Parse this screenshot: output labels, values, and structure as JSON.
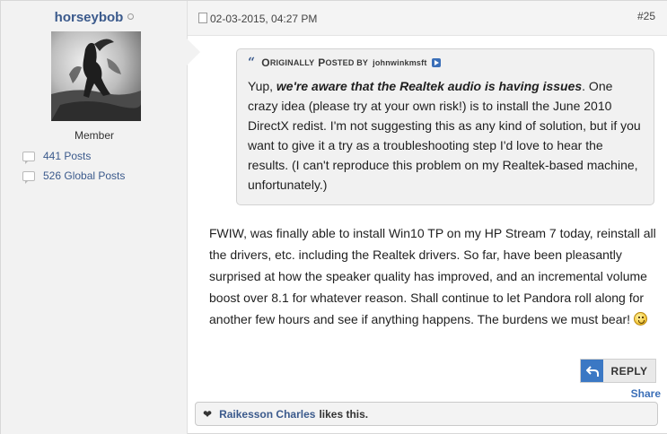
{
  "user": {
    "name": "horseybob",
    "title": "Member",
    "posts": "441 Posts",
    "global_posts": "526 Global Posts"
  },
  "post": {
    "date": "02-03-2015, 04:27 PM",
    "number": "#25"
  },
  "quote": {
    "header_first": "O",
    "header_rest": "riginally",
    "header_second": "P",
    "header_second_rest": "osted by",
    "author": "johnwinkmsft",
    "text_prefix": "Yup, ",
    "text_emphasis": "we're aware that the Realtek audio is having issues",
    "text_suffix": ". One crazy idea (please try at your own risk!) is to install the June 2010 DirectX redist. I'm not suggesting this as any kind of solution, but if you want to give it a try as a troubleshooting step I'd love to hear the results. (I can't reproduce this problem on my Realtek-based machine, unfortunately.)"
  },
  "message": {
    "text": "FWIW, was finally able to install Win10 TP on my HP Stream 7 today, reinstall all the drivers, etc. including the Realtek drivers. So far, have been pleasantly surprised at how the speaker quality has improved, and an incremental volume boost over 8.1 for whatever reason. Shall continue to let Pandora roll along for another few hours and see if anything happens. The burdens we must bear!"
  },
  "actions": {
    "reply_label": "REPLY",
    "share_label": "Share"
  },
  "likes": {
    "liker": "Raikesson Charles",
    "suffix": "likes this."
  },
  "colors": {
    "link": "#3b5a8c",
    "accent": "#3b78c4"
  },
  "icons": [
    "online-status-icon",
    "post-count-icon",
    "document-icon",
    "quote-icon",
    "go-to-post-icon",
    "smiley-icon",
    "reply-arrow-icon",
    "heart-icon"
  ]
}
